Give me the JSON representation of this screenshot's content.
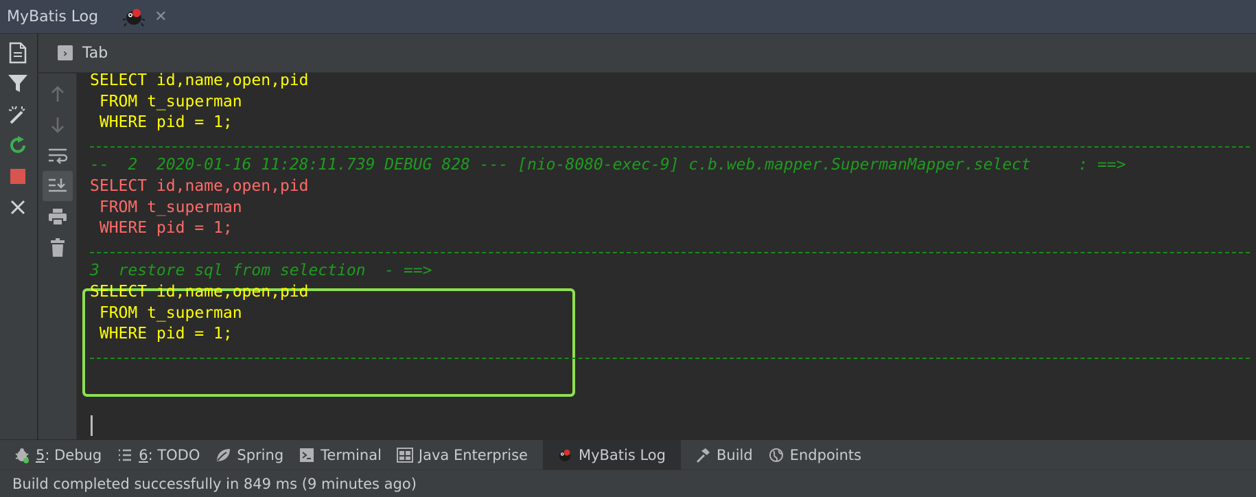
{
  "window": {
    "title": "MyBatis Log",
    "close_glyph": "✕"
  },
  "tab": {
    "icon_glyph": "›",
    "label": "Tab"
  },
  "outer_toolbar": [
    "file-icon",
    "filter-icon",
    "magic-wand-icon",
    "rerun-icon",
    "stop-icon",
    "close-icon"
  ],
  "inner_toolbar": [
    "arrow-up-icon",
    "arrow-down-icon",
    "soft-wrap-icon",
    "scroll-to-end-icon",
    "print-icon",
    "trash-icon"
  ],
  "console": {
    "block1": {
      "line1": "SELECT id,name,open,pid",
      "line2": " FROM t_superman",
      "line3": " WHERE pid = 1;"
    },
    "block2": {
      "header": "--  2  2020-01-16 11:28:11.739 DEBUG 828 --- [nio-8080-exec-9] c.b.web.mapper.SupermanMapper.select     : ==>",
      "line1": "SELECT id,name,open,pid",
      "line2": " FROM t_superman",
      "line3": " WHERE pid = 1;"
    },
    "block3": {
      "header": "3  restore sql from selection  - ==>",
      "line1": "SELECT id,name,open,pid",
      "line2": " FROM t_superman",
      "line3": " WHERE pid = 1;"
    }
  },
  "bottom_bar": {
    "debug_num": "5",
    "debug_label": ": Debug",
    "todo_num": "6",
    "todo_label": ": TODO",
    "spring": "Spring",
    "terminal": "Terminal",
    "java_enterprise": "Java Enterprise",
    "mybatis_log": "MyBatis Log",
    "build": "Build",
    "endpoints": "Endpoints"
  },
  "status": "Build completed successfully in 849 ms (9 minutes ago)",
  "colors": {
    "sql_yellow": "#ffff00",
    "sql_red": "#ff6b68",
    "log_green": "#1f9a1f",
    "highlight": "#8fe050"
  }
}
